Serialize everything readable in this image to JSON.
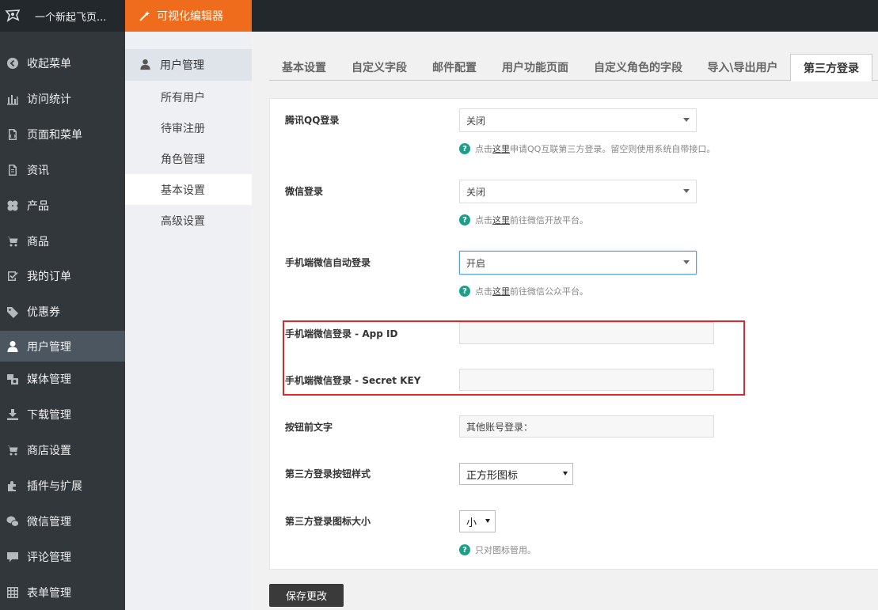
{
  "topbar": {
    "site_name": "一个新起飞页...",
    "editor_label": "可视化编辑器"
  },
  "sidebar": {
    "items": [
      {
        "label": "收起菜单",
        "icon": "collapse-icon"
      },
      {
        "label": "访问统计",
        "icon": "stats-icon"
      },
      {
        "label": "页面和菜单",
        "icon": "page-icon"
      },
      {
        "label": "资讯",
        "icon": "news-icon"
      },
      {
        "label": "产品",
        "icon": "product-icon"
      },
      {
        "label": "商品",
        "icon": "cart-icon"
      },
      {
        "label": "我的订单",
        "icon": "order-icon"
      },
      {
        "label": "优惠券",
        "icon": "coupon-icon"
      },
      {
        "label": "用户管理",
        "icon": "user-icon",
        "active": true
      },
      {
        "label": "媒体管理",
        "icon": "media-icon"
      },
      {
        "label": "下载管理",
        "icon": "download-icon"
      },
      {
        "label": "商店设置",
        "icon": "store-icon"
      },
      {
        "label": "插件与扩展",
        "icon": "plugin-icon"
      },
      {
        "label": "微信管理",
        "icon": "wechat-icon"
      },
      {
        "label": "评论管理",
        "icon": "comment-icon"
      },
      {
        "label": "表单管理",
        "icon": "form-icon"
      }
    ]
  },
  "submenu": {
    "title": "用户管理",
    "items": [
      "所有用户",
      "待审注册",
      "角色管理",
      "基本设置",
      "高级设置"
    ],
    "active_index": 3
  },
  "tabs": {
    "items": [
      "基本设置",
      "自定义字段",
      "邮件配置",
      "用户功能页面",
      "自定义角色的字段",
      "导入\\导出用户",
      "第三方登录"
    ],
    "active_index": 6
  },
  "form": {
    "qq_login": {
      "label": "腾讯QQ登录",
      "value": "关闭",
      "hint_prefix": "点击",
      "hint_link": "这里",
      "hint_suffix": "申请QQ互联第三方登录。留空则使用系统自带接口。"
    },
    "wechat_login": {
      "label": "微信登录",
      "value": "关闭",
      "hint_prefix": "点击",
      "hint_link": "这里",
      "hint_suffix": "前往微信开放平台。"
    },
    "mobile_wechat_auto": {
      "label": "手机端微信自动登录",
      "value": "开启",
      "hint_prefix": "点击",
      "hint_link": "这里",
      "hint_suffix": "前往微信公众平台。"
    },
    "app_id": {
      "label": "手机端微信登录 - App ID",
      "value": ""
    },
    "secret_key": {
      "label": "手机端微信登录 - Secret KEY",
      "value": ""
    },
    "button_prefix": {
      "label": "按钮前文字",
      "value": "其他账号登录："
    },
    "button_style": {
      "label": "第三方登录按钮样式",
      "value": "正方形图标"
    },
    "icon_size": {
      "label": "第三方登录图标大小",
      "value": "小",
      "hint": "只对图标管用。"
    }
  },
  "save_label": "保存更改",
  "colors": {
    "accent": "#f06c1d",
    "sidebar_bg": "#32373c",
    "highlight_border": "#e0262b",
    "hint_icon": "#1aa08a"
  }
}
